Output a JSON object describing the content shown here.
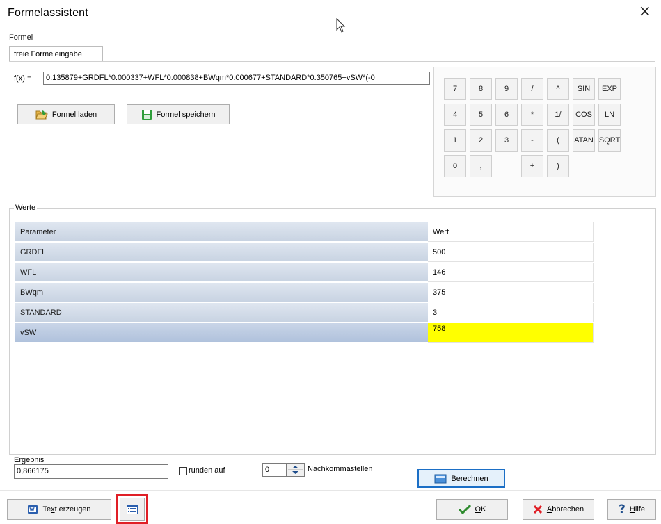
{
  "window": {
    "title": "Formelassistent",
    "close_glyph": "×"
  },
  "formel": {
    "group_label": "Formel",
    "tab_label": "freie Formeleingabe",
    "fx_label": "f(x) =",
    "fx_value": "0.135879+GRDFL*0.000337+WFL*0.000838+BWqm*0.000677+STANDARD*0.350765+vSW*(-0",
    "load_button": "Formel laden",
    "save_button": "Formel speichern"
  },
  "keypad": {
    "rows": [
      [
        "7",
        "8",
        "9",
        "/",
        "^",
        "SIN",
        "EXP"
      ],
      [
        "4",
        "5",
        "6",
        "*",
        "1/",
        "COS",
        "LN"
      ],
      [
        "1",
        "2",
        "3",
        "-",
        "(",
        "ATAN",
        "SQRT"
      ],
      [
        "0",
        ",",
        "",
        "+",
        ")",
        "",
        ""
      ]
    ]
  },
  "werte": {
    "group_label": "Werte",
    "header": {
      "param": "Parameter",
      "value": "Wert"
    },
    "rows": [
      {
        "param": "GRDFL",
        "value": "500"
      },
      {
        "param": "WFL",
        "value": "146"
      },
      {
        "param": "BWqm",
        "value": "375"
      },
      {
        "param": "STANDARD",
        "value": "3"
      },
      {
        "param": "vSW",
        "value": "758"
      }
    ]
  },
  "ergebnis": {
    "label": "Ergebnis",
    "value": "0,866175",
    "runden_label": "runden auf",
    "decimals": "0",
    "nachkomma_label": "Nachkommastellen",
    "berechnen_label_rest": "erechnen",
    "berechnen_mnemonic": "B"
  },
  "footer": {
    "text_button_pre": "Te",
    "text_button_mnemonic": "x",
    "text_button_post": "t erzeugen",
    "ok_mnemonic": "O",
    "ok_rest": "K",
    "cancel_mnemonic": "A",
    "cancel_rest": "bbrechen",
    "help_mnemonic": "H",
    "help_rest": "ilfe",
    "accent_red": "#e01f26",
    "highlight_yellow": "#ffff00"
  }
}
